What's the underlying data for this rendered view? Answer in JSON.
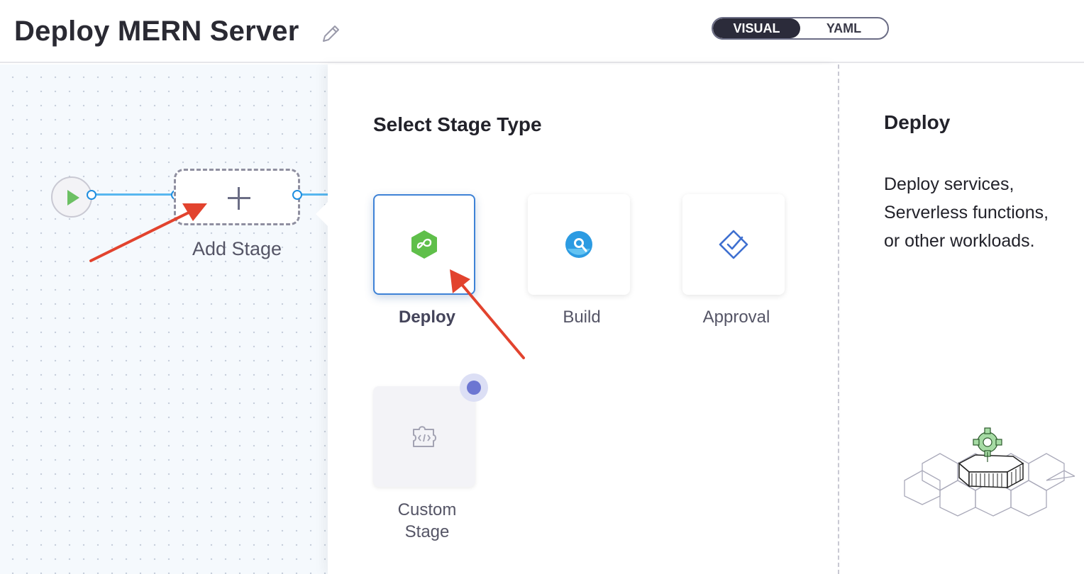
{
  "header": {
    "title": "Deploy MERN Server",
    "view_toggle": {
      "visual_label": "VISUAL",
      "yaml_label": "YAML",
      "selected": "VISUAL"
    }
  },
  "canvas": {
    "add_stage_label": "Add Stage"
  },
  "stage_picker": {
    "title": "Select Stage Type",
    "stages": [
      {
        "label": "Deploy",
        "icon": "deploy-icon",
        "selected": true
      },
      {
        "label": "Build",
        "icon": "build-icon",
        "selected": false
      },
      {
        "label": "Approval",
        "icon": "approval-icon",
        "selected": false
      },
      {
        "label_line1": "Custom",
        "label_line2": "Stage",
        "icon": "custom-stage-icon",
        "selected": false
      }
    ]
  },
  "description": {
    "title": "Deploy",
    "lines": [
      "Deploy services,",
      "Serverless functions,",
      "or other workloads."
    ]
  },
  "colors": {
    "accent": "#3e82d6",
    "deploy_green": "#5fbf4a",
    "build_blue": "#2c9be2",
    "annotation_arrow": "#e2432e",
    "toggle_active": "#2b2b3a"
  }
}
